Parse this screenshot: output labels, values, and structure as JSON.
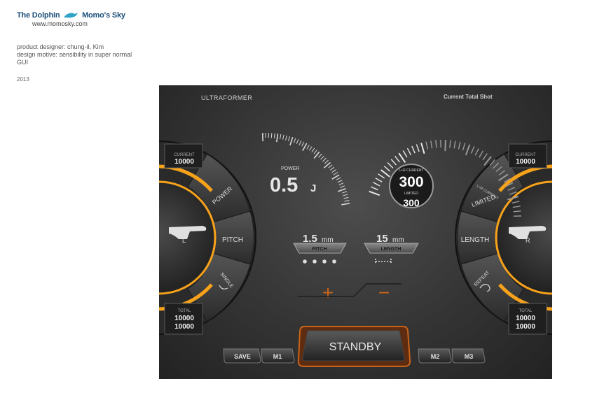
{
  "brand": {
    "name_left": "The Dolphin",
    "name_right": "Momo's Sky",
    "url": "www.momosky.com"
  },
  "info": {
    "designer": "product designer: chung-il, Kim",
    "motive": "design motive: sensibility in super normal",
    "type": "GUI",
    "year": "2013"
  },
  "device": {
    "logo": "ULTRAFORMER",
    "header_right": "Current Total Shot",
    "left_dial": {
      "current_label": "CURRENT",
      "current_value": "10000",
      "handpiece_label": "L",
      "total_label": "TOTAL",
      "total_value_1": "10000",
      "total_value_2": "10000",
      "menu": [
        "POWER",
        "PITCH",
        "SINGLE"
      ]
    },
    "right_dial": {
      "current_label": "CURRENT",
      "current_value": "10000",
      "handpiece_label": "R",
      "total_label": "TOTAL",
      "total_value_1": "10000",
      "total_value_2": "10000",
      "menu_limited_small": "L+R CURRENT",
      "menu_limited": "LIMITED",
      "menu_length": "LENGTH",
      "menu_repeat": "REPEAT"
    },
    "power": {
      "label": "POWER",
      "value": "0.5",
      "unit": "J"
    },
    "shot_counter": {
      "label": "L+R CURRENT",
      "value": "300",
      "limited_label": "LIMITED",
      "limited_value": "300",
      "level": 0.35
    },
    "pitch": {
      "value": "1.5",
      "unit": "mm",
      "label": "PITCH"
    },
    "length": {
      "value": "15",
      "unit": "mm",
      "label": "LENGTH"
    },
    "plus_symbol": "+",
    "minus_symbol": "−",
    "buttons": {
      "save": "SAVE",
      "m1": "M1",
      "standby": "STANDBY",
      "m2": "M2",
      "m3": "M3"
    },
    "colors": {
      "accent_orange": "#f7a21b",
      "accent_dark_orange": "#c8641a",
      "panel_bg": "#3a3a3a",
      "text_light": "#e6e6e6"
    }
  }
}
